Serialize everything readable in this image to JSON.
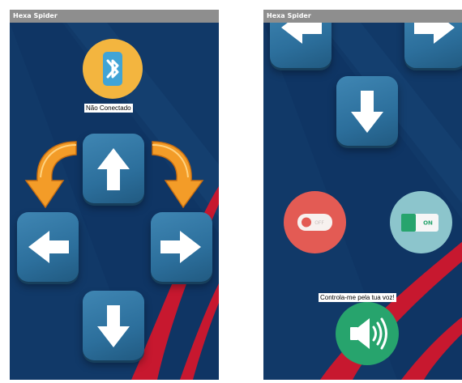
{
  "left_screen": {
    "app_title": "Hexa Spider",
    "connection_status": "Não Conectado"
  },
  "right_screen": {
    "app_title": "Hexa Spider",
    "voice_label": "Controla-me pela tua voz!",
    "off_toggle_text": "OFF",
    "on_toggle_text": "ON"
  },
  "colors": {
    "background": "#123a69",
    "accent_red": "#c7182f",
    "button_blue": "#2c6f9c",
    "bluetooth_yellow": "#f3b53f",
    "off_button": "#e35b54",
    "on_button": "#8cc5cc",
    "sound_button": "#27a46d",
    "turn_arrow": "#f39c28"
  },
  "icons": [
    "bluetooth-icon",
    "arrow-up-icon",
    "arrow-down-icon",
    "arrow-left-icon",
    "arrow-right-icon",
    "turn-left-icon",
    "turn-right-icon",
    "toggle-off-icon",
    "toggle-on-icon",
    "speaker-icon"
  ]
}
